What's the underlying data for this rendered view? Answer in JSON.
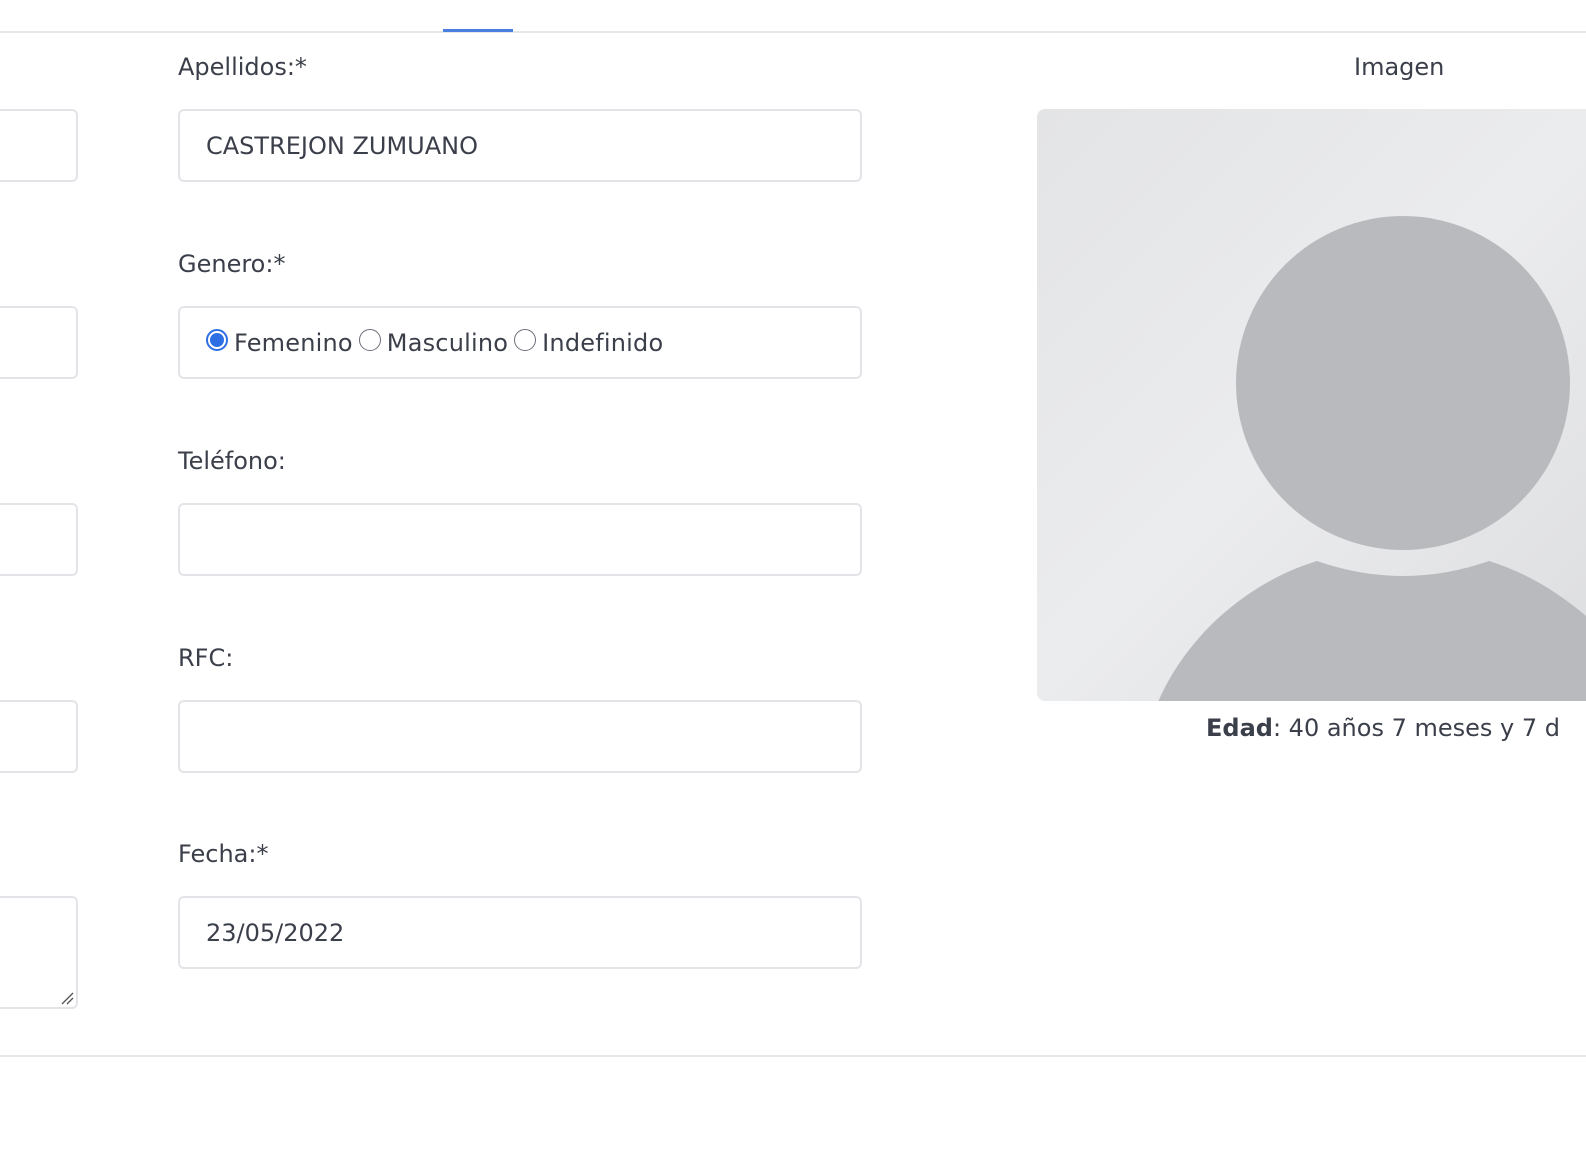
{
  "form": {
    "apellidos": {
      "label": "Apellidos:*",
      "value": "CASTREJON ZUMUANO"
    },
    "genero": {
      "label": "Genero:*",
      "options": [
        "Femenino",
        "Masculino",
        "Indefinido"
      ],
      "selected": "Femenino"
    },
    "telefono": {
      "label": "Teléfono:",
      "value": ""
    },
    "rfc": {
      "label": "RFC:",
      "value": ""
    },
    "fecha": {
      "label": "Fecha:*",
      "value": "23/05/2022"
    }
  },
  "image_panel": {
    "title": "Imagen",
    "age_label": "Edad",
    "age_value": ": 40 años 7 meses y 7 d"
  },
  "colors": {
    "accent": "#2f6fe4",
    "tab_indicator": "#4a7fe0",
    "border": "#e2e4e8",
    "avatar_fill": "#b9babd"
  }
}
